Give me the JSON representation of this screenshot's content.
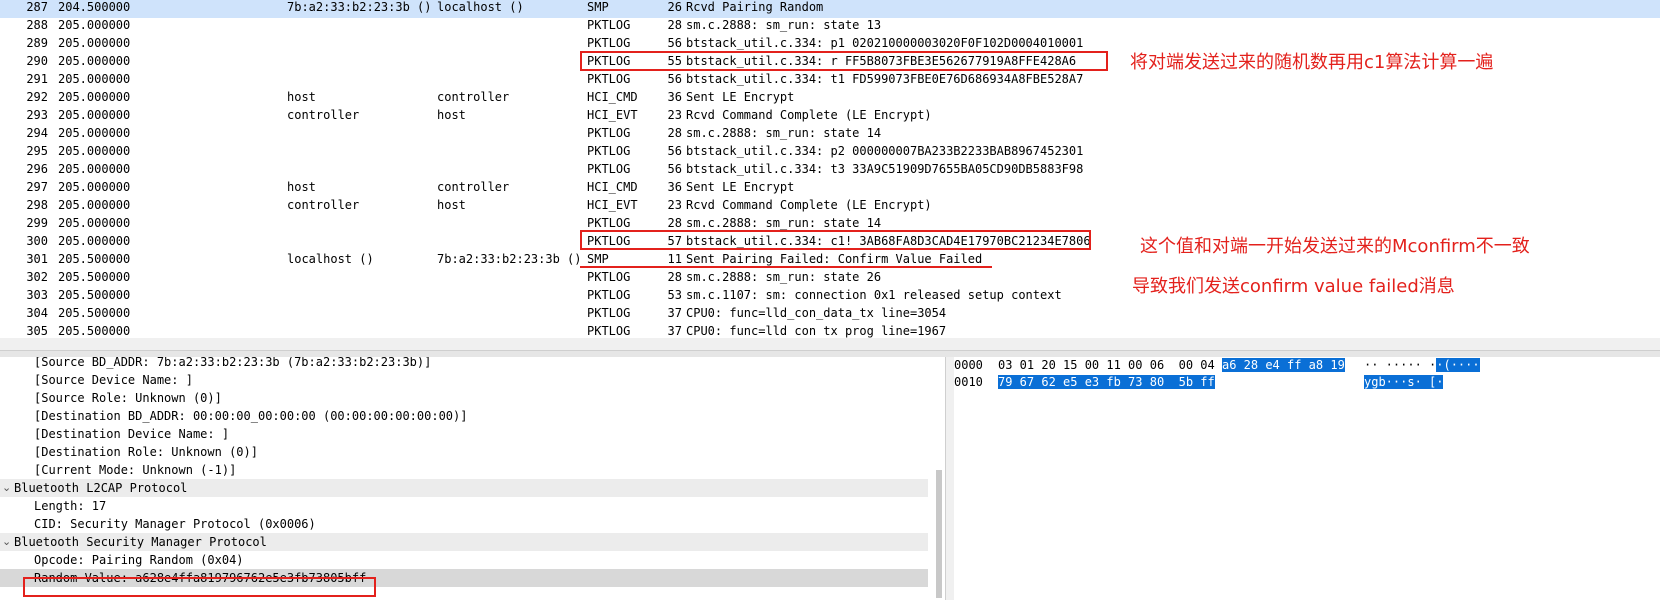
{
  "packets": [
    {
      "no": "287",
      "time": "204.500000",
      "src": "7b:a2:33:b2:23:3b ()",
      "dst": "localhost ()",
      "proto": "SMP",
      "len": "26",
      "info": "Rcvd Pairing Random",
      "selected": true
    },
    {
      "no": "288",
      "time": "205.000000",
      "src": "",
      "dst": "",
      "proto": "PKTLOG",
      "len": "28",
      "info": "sm.c.2888: sm_run: state 13"
    },
    {
      "no": "289",
      "time": "205.000000",
      "src": "",
      "dst": "",
      "proto": "PKTLOG",
      "len": "56",
      "info": "btstack_util.c.334: p1 020210000003020F0F102D0004010001"
    },
    {
      "no": "290",
      "time": "205.000000",
      "src": "",
      "dst": "",
      "proto": "PKTLOG",
      "len": "55",
      "info": "btstack_util.c.334: r FF5B8073FBE3E562677919A8FFE428A6"
    },
    {
      "no": "291",
      "time": "205.000000",
      "src": "",
      "dst": "",
      "proto": "PKTLOG",
      "len": "56",
      "info": "btstack_util.c.334: t1 FD599073FBE0E76D686934A8FBE528A7"
    },
    {
      "no": "292",
      "time": "205.000000",
      "src": "host",
      "dst": "controller",
      "proto": "HCI_CMD",
      "len": "36",
      "info": "Sent LE Encrypt"
    },
    {
      "no": "293",
      "time": "205.000000",
      "src": "controller",
      "dst": "host",
      "proto": "HCI_EVT",
      "len": "23",
      "info": "Rcvd Command Complete (LE Encrypt)"
    },
    {
      "no": "294",
      "time": "205.000000",
      "src": "",
      "dst": "",
      "proto": "PKTLOG",
      "len": "28",
      "info": "sm.c.2888: sm_run: state 14"
    },
    {
      "no": "295",
      "time": "205.000000",
      "src": "",
      "dst": "",
      "proto": "PKTLOG",
      "len": "56",
      "info": "btstack_util.c.334: p2 000000007BA233B2233BAB8967452301"
    },
    {
      "no": "296",
      "time": "205.000000",
      "src": "",
      "dst": "",
      "proto": "PKTLOG",
      "len": "56",
      "info": "btstack_util.c.334: t3 33A9C51909D7655BA05CD90DB5883F98"
    },
    {
      "no": "297",
      "time": "205.000000",
      "src": "host",
      "dst": "controller",
      "proto": "HCI_CMD",
      "len": "36",
      "info": "Sent LE Encrypt"
    },
    {
      "no": "298",
      "time": "205.000000",
      "src": "controller",
      "dst": "host",
      "proto": "HCI_EVT",
      "len": "23",
      "info": "Rcvd Command Complete (LE Encrypt)"
    },
    {
      "no": "299",
      "time": "205.000000",
      "src": "",
      "dst": "",
      "proto": "PKTLOG",
      "len": "28",
      "info": "sm.c.2888: sm_run: state 14"
    },
    {
      "no": "300",
      "time": "205.000000",
      "src": "",
      "dst": "",
      "proto": "PKTLOG",
      "len": "57",
      "info": "btstack_util.c.334: c1! 3AB68FA8D3CAD4E17970BC21234E7806"
    },
    {
      "no": "301",
      "time": "205.500000",
      "src": "localhost ()",
      "dst": "7b:a2:33:b2:23:3b ()",
      "proto": "SMP",
      "len": "11",
      "info": "Sent Pairing Failed: Confirm Value Failed"
    },
    {
      "no": "302",
      "time": "205.500000",
      "src": "",
      "dst": "",
      "proto": "PKTLOG",
      "len": "28",
      "info": "sm.c.2888: sm_run: state 26"
    },
    {
      "no": "303",
      "time": "205.500000",
      "src": "",
      "dst": "",
      "proto": "PKTLOG",
      "len": "53",
      "info": "sm.c.1107: sm: connection 0x1 released setup context"
    },
    {
      "no": "304",
      "time": "205.500000",
      "src": "",
      "dst": "",
      "proto": "PKTLOG",
      "len": "37",
      "info": "CPU0: func=lld_con_data_tx line=3054"
    },
    {
      "no": "305",
      "time": "205.500000",
      "src": "",
      "dst": "",
      "proto": "PKTLOG",
      "len": "37",
      "info": "CPU0: func=lld con tx prog line=1967"
    }
  ],
  "annotations": {
    "note1": "将对端发送过来的随机数再用c1算法计算一遍",
    "note2": "这个值和对端一开始发送过来的Mconfirm不一致",
    "note3": "导致我们发送confirm value failed消息"
  },
  "details": [
    {
      "text": "[Source BD_ADDR: 7b:a2:33:b2:23:3b (7b:a2:33:b2:23:3b)]",
      "indent": 2
    },
    {
      "text": "[Source Device Name: ]",
      "indent": 2
    },
    {
      "text": "[Source Role: Unknown (0)]",
      "indent": 2
    },
    {
      "text": "[Destination BD_ADDR: 00:00:00_00:00:00 (00:00:00:00:00:00)]",
      "indent": 2
    },
    {
      "text": "[Destination Device Name: ]",
      "indent": 2
    },
    {
      "text": "[Destination Role: Unknown (0)]",
      "indent": 2
    },
    {
      "text": "[Current Mode: Unknown (-1)]",
      "indent": 2
    },
    {
      "text": "Bluetooth L2CAP Protocol",
      "indent": 1,
      "header": true
    },
    {
      "text": "Length: 17",
      "indent": 2
    },
    {
      "text": "CID: Security Manager Protocol (0x0006)",
      "indent": 2
    },
    {
      "text": "Bluetooth Security Manager Protocol",
      "indent": 1,
      "header": true
    },
    {
      "text": "Opcode: Pairing Random (0x04)",
      "indent": 2
    },
    {
      "text": "Random Value: a628e4ffa819796762e5e3fb73805bff",
      "indent": 2,
      "selected": true
    }
  ],
  "bytes": [
    {
      "offset": "0000",
      "hex_plain": "03 01 20 15 00 11 00 06  00 04 ",
      "hex_hi": "a6 28 e4 ff a8 19",
      "asc_plain": "·· ····· ·",
      "asc_hi": "·(····"
    },
    {
      "offset": "0010",
      "hex_plain": "",
      "hex_hi": "79 67 62 e5 e3 fb 73 80  5b ff",
      "asc_plain": "",
      "asc_hi": "ygb···s· [·"
    }
  ],
  "colors": {
    "selected_row": "#cfe3fb",
    "annotation": "#e3211c",
    "byte_highlight": "#0a6fd6"
  },
  "icons": {
    "expand": "chevron-down-icon"
  }
}
